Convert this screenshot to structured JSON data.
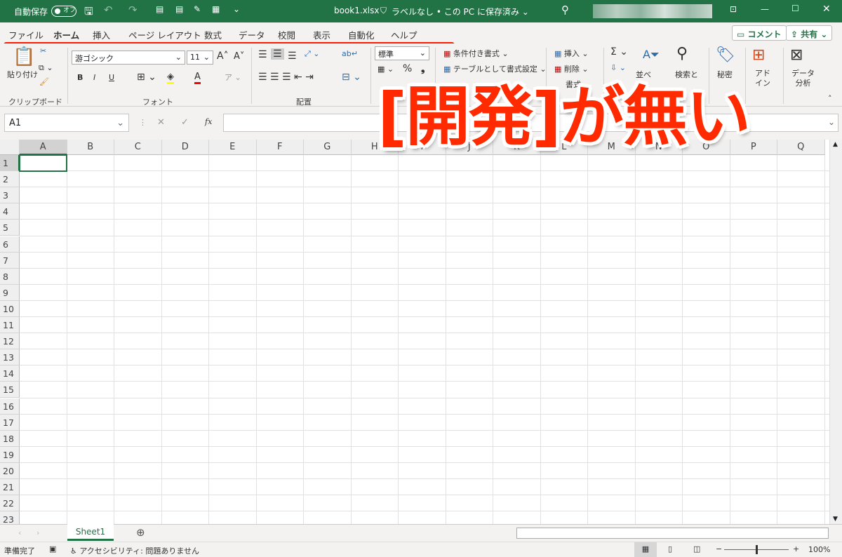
{
  "titlebar": {
    "autosave_label": "自動保存",
    "autosave_state": "オフ",
    "filename": "book1.xlsx",
    "label_status": "ラベルなし • この PC に保存済み ⌄",
    "icons": [
      "save-icon",
      "undo-icon",
      "redo-icon",
      "print-preview-icon",
      "print-icon",
      "pen-icon",
      "form-icon",
      "customize-icon",
      "search-icon",
      "ribbon-display-icon",
      "minimize-icon",
      "maximize-icon",
      "close-icon"
    ]
  },
  "tabs": [
    {
      "label": "ファイル"
    },
    {
      "label": "ホーム",
      "active": true
    },
    {
      "label": "挿入"
    },
    {
      "label": "ページ レイアウト"
    },
    {
      "label": "数式"
    },
    {
      "label": "データ"
    },
    {
      "label": "校閲"
    },
    {
      "label": "表示"
    },
    {
      "label": "自動化"
    },
    {
      "label": "ヘルプ"
    }
  ],
  "actions": {
    "comment": "コメント",
    "share": "共有"
  },
  "ribbon": {
    "clipboard": {
      "paste": "貼り付け",
      "label": "クリップボード"
    },
    "font": {
      "name": "游ゴシック",
      "size": "11",
      "bold": "B",
      "italic": "I",
      "underline": "U",
      "label": "フォント",
      "highlight_color": "#ffff00",
      "font_color": "#ff0000"
    },
    "alignment": {
      "label": "配置"
    },
    "number": {
      "format": "標準",
      "percent": "%",
      "comma": "❟"
    },
    "styles": {
      "conditional": "条件付き書式 ⌄",
      "table": "テーブルとして書式設定 ⌄"
    },
    "cells": {
      "insert": "挿入",
      "delete": "削除",
      "format": "書式"
    },
    "editing": {
      "sum": "Σ ⌄",
      "sort": "並べ",
      "find": "検索と"
    },
    "sensitivity": "秘密",
    "addins": "アド\nイン",
    "analyze": "データ\n分析"
  },
  "formula_bar": {
    "name_box": "A1",
    "fx": "fx",
    "cancel": "✕",
    "enter": "✓"
  },
  "columns": [
    "A",
    "B",
    "C",
    "D",
    "E",
    "F",
    "G",
    "H",
    "I",
    "J",
    "K",
    "L",
    "M",
    "N",
    "O",
    "P",
    "Q"
  ],
  "rows": [
    "1",
    "2",
    "3",
    "4",
    "5",
    "6",
    "7",
    "8",
    "9",
    "10",
    "11",
    "12",
    "13",
    "14",
    "15",
    "16",
    "17",
    "18",
    "19",
    "20",
    "21",
    "22",
    "23"
  ],
  "selected_cell": "A1",
  "sheets": [
    {
      "name": "Sheet1",
      "active": true
    }
  ],
  "status": {
    "ready": "準備完了",
    "accessibility": "アクセシビリティ: 問題ありません",
    "zoom": "100%",
    "zoom_percent": 100
  },
  "overlay": {
    "text": "[開発]が無い",
    "color": "#ff2a00"
  },
  "colors": {
    "accent": "#217346",
    "highlight": "#ff1a00"
  }
}
